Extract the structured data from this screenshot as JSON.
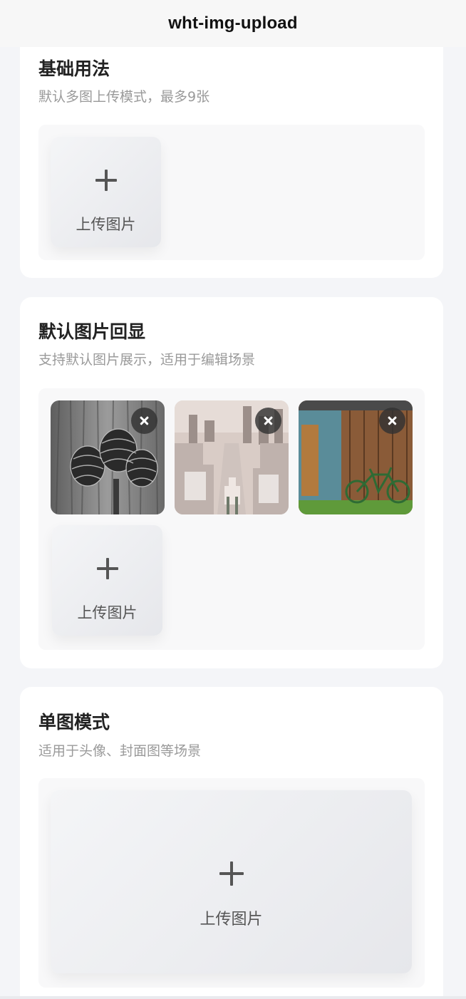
{
  "navbar": {
    "title": "wht-img-upload"
  },
  "sections": [
    {
      "title": "基础用法",
      "description": "默认多图上传模式，最多9张",
      "upload_label": "上传图片"
    },
    {
      "title": "默认图片回显",
      "description": "支持默认图片展示，适用于编辑场景",
      "upload_label": "上传图片",
      "images": [
        {
          "subject": "pinecones",
          "delete_icon": "close-icon"
        },
        {
          "subject": "city-aerial",
          "delete_icon": "close-icon"
        },
        {
          "subject": "bicycle-barn",
          "delete_icon": "close-icon"
        }
      ]
    },
    {
      "title": "单图模式",
      "description": "适用于头像、封面图等场景",
      "upload_label": "上传图片"
    }
  ],
  "icons": {
    "add": "plus-icon",
    "remove": "close-icon"
  },
  "colors": {
    "page_bg": "#f4f5f8",
    "card_bg": "#ffffff",
    "text": "#222222",
    "muted": "#9a9a9a",
    "upload_bg": "#f8f8f9"
  }
}
